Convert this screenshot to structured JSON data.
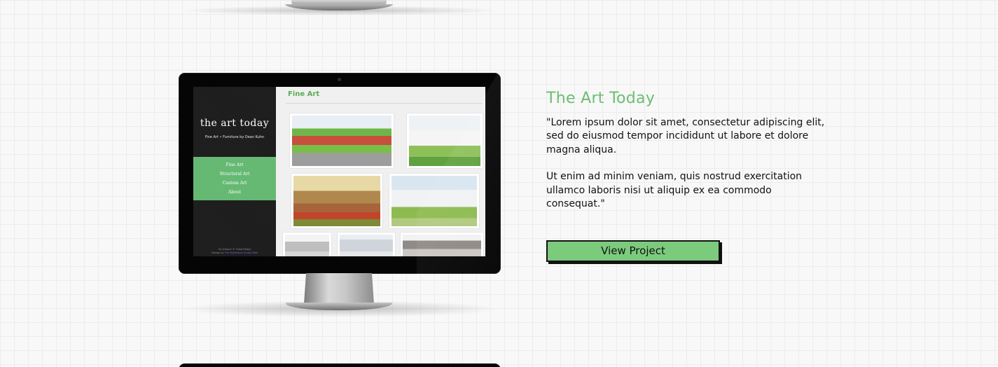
{
  "project": {
    "title": "The Art Today",
    "description": [
      "\"Lorem ipsum dolor sit amet, consectetur adipiscing elit, sed do eiusmod tempor incididunt ut labore et dolore magna aliqua.",
      "Ut enim ad minim veniam, quis nostrud exercitation ullamco laboris nisi ut aliquip ex ea commodo consequat.\""
    ],
    "button_label": "View Project"
  },
  "preview": {
    "logo": "the art today",
    "tagline": "Fine Art • Furniture by Dean Kuhn",
    "nav": [
      "Fine Art",
      "Structural Art",
      "Custom Art",
      "About"
    ],
    "section_heading": "Fine Art",
    "footer_line1": "All Artwork © TheArtToday",
    "footer_line2_prefix": "Design by",
    "footer_link": "The Revolution Studio Web"
  },
  "colors": {
    "accent": "#6cbd72",
    "button_bg": "#7ccb7d",
    "nav_bg": "#66b973"
  }
}
